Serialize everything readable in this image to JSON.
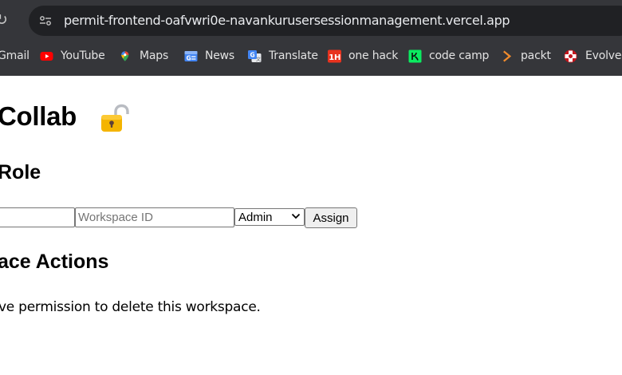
{
  "browser": {
    "url": "permit-frontend-oafvwri0e-navankurusersessionmanagement.vercel.app",
    "bookmarks": [
      {
        "label": "Gmail",
        "icon": "gmail-icon"
      },
      {
        "label": "YouTube",
        "icon": "youtube-icon",
        "color": "#ff0000"
      },
      {
        "label": "Maps",
        "icon": "maps-icon"
      },
      {
        "label": "News",
        "icon": "google-news-icon"
      },
      {
        "label": "Translate",
        "icon": "google-translate-icon"
      },
      {
        "label": "one hack",
        "icon": "one-hack-icon",
        "badge": "1H"
      },
      {
        "label": "code camp",
        "icon": "code-camp-icon"
      },
      {
        "label": "packt",
        "icon": "packt-icon"
      },
      {
        "label": "Evolve-l",
        "icon": "evolve-icon"
      }
    ]
  },
  "page": {
    "title": "Collab",
    "title_icon": "lock-icon",
    "role_heading": "Role",
    "form": {
      "user_placeholder": "",
      "workspace_placeholder": "Workspace ID",
      "role_selected": "Admin",
      "role_options": [
        "Admin"
      ],
      "submit_label": "Assign"
    },
    "actions_heading": "ace Actions",
    "message": "ve permission to delete this workspace."
  },
  "colors": {
    "chrome": "#35363a",
    "omnibox": "#202124",
    "accent": "#1a73e8"
  }
}
